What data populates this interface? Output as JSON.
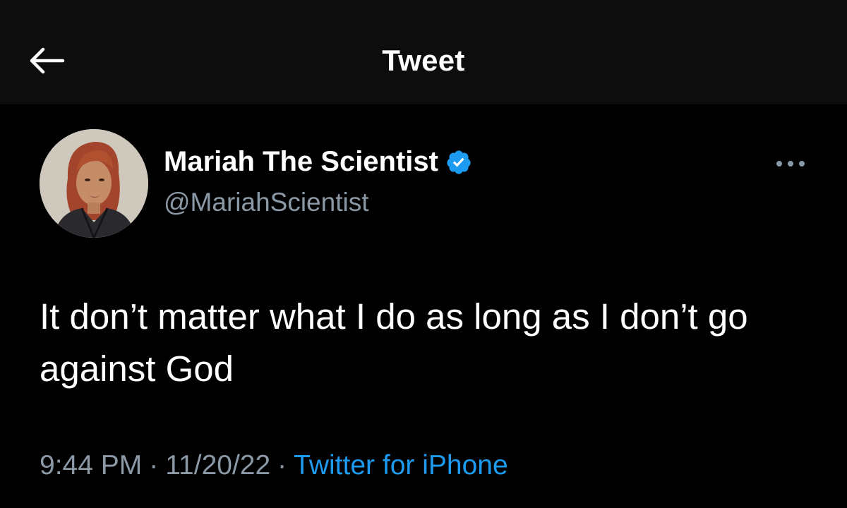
{
  "header": {
    "title": "Tweet",
    "back_icon": "arrow-left-icon"
  },
  "tweet": {
    "author": {
      "display_name": "Mariah The Scientist",
      "handle": "@MariahScientist",
      "verified": true,
      "verified_icon": "verified-badge-icon",
      "verified_color": "#1d9bf0"
    },
    "more_icon": "more-horizontal-icon",
    "text": "It don’t matter what I do as long as I don’t go against God",
    "time": "9:44 PM",
    "date": "11/20/22",
    "separator": "·",
    "source": "Twitter for iPhone"
  },
  "colors": {
    "background": "#000000",
    "header_background": "#0d0d0d",
    "text_primary": "#ffffff",
    "text_secondary": "#8b98a5",
    "accent": "#1d9bf0"
  }
}
